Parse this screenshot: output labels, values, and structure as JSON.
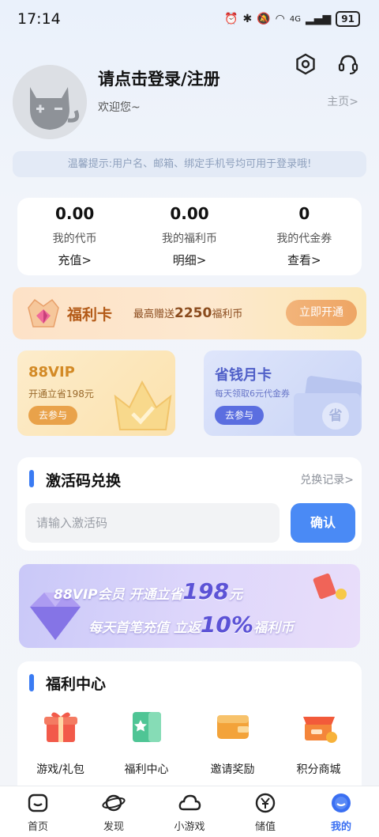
{
  "status_bar": {
    "time": "17:14",
    "network": "4G",
    "battery": "91"
  },
  "profile": {
    "title": "请点击登录/注册",
    "welcome": "欢迎您~",
    "homepage_link": "主页>"
  },
  "tip": "温馨提示:用户名、邮箱、绑定手机号均可用于登录哦!",
  "wallet": [
    {
      "value": "0.00",
      "label": "我的代币",
      "action": "充值>"
    },
    {
      "value": "0.00",
      "label": "我的福利币",
      "action": "明细>"
    },
    {
      "value": "0",
      "label": "我的代金券",
      "action": "查看>"
    }
  ],
  "benefit_card": {
    "title": "福利卡",
    "desc_prefix": "最高赠送",
    "desc_amount": "2250",
    "desc_suffix": "福利币",
    "button": "立即开通"
  },
  "vip_card": {
    "title": "88VIP",
    "desc": "开通立省198元",
    "button": "去参与"
  },
  "month_card": {
    "title": "省钱月卡",
    "desc": "每天领取6元代金券",
    "button": "去参与",
    "badge": "省"
  },
  "redeem": {
    "title": "激活码兑换",
    "history": "兑换记录>",
    "placeholder": "请输入激活码",
    "confirm": "确认"
  },
  "banner": {
    "line1_a": "88VIP会员 开通立省",
    "line1_num": "198",
    "line1_b": "元",
    "line2_a": "每天首笔充值 立返",
    "line2_num": "10%",
    "line2_b": "福利币"
  },
  "welfare": {
    "title": "福利中心",
    "items": [
      {
        "label": "游戏/礼包",
        "icon": "gift-icon"
      },
      {
        "label": "福利中心",
        "icon": "book-star-icon"
      },
      {
        "label": "邀请奖励",
        "icon": "wallet-icon"
      },
      {
        "label": "积分商城",
        "icon": "shop-icon"
      }
    ]
  },
  "tabbar": [
    {
      "label": "首页",
      "icon": "home-icon",
      "active": false
    },
    {
      "label": "发现",
      "icon": "planet-icon",
      "active": false
    },
    {
      "label": "小游戏",
      "icon": "cloud-icon",
      "active": false
    },
    {
      "label": "储值",
      "icon": "yuan-icon",
      "active": false
    },
    {
      "label": "我的",
      "icon": "profile-icon",
      "active": true
    }
  ],
  "colors": {
    "accent": "#3a7bf3",
    "benefit": "#b35a17",
    "vip_button": "#e9a24a",
    "month_button": "#5b6ee0"
  }
}
